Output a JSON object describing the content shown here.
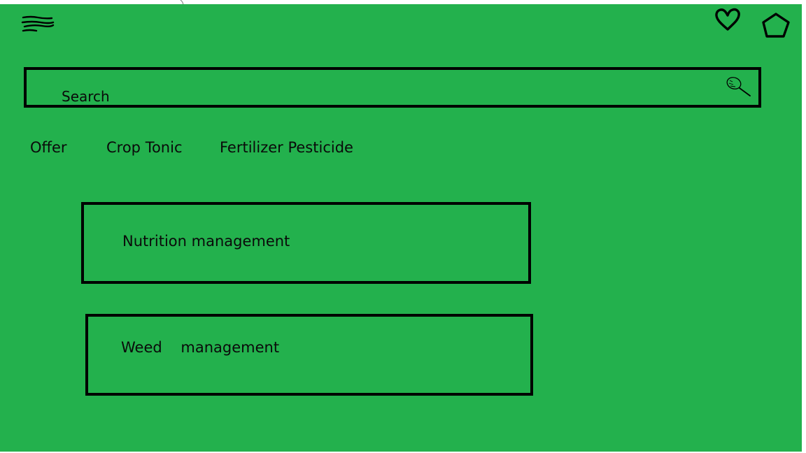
{
  "header": {
    "menu_icon": "hamburger-menu-icon",
    "favorites_icon": "heart-icon",
    "home_icon": "pentagon-home-icon"
  },
  "search": {
    "placeholder": "Search",
    "icon": "magnifier-search-icon"
  },
  "categories": [
    {
      "label": "Offer"
    },
    {
      "label": "Crop Tonic"
    },
    {
      "label": "Fertilizer Pesticide"
    }
  ],
  "cards": [
    {
      "title": "Nutrition management"
    },
    {
      "title": "Weed    management"
    }
  ],
  "colors": {
    "background": "#23b14d",
    "ink": "#000000"
  }
}
